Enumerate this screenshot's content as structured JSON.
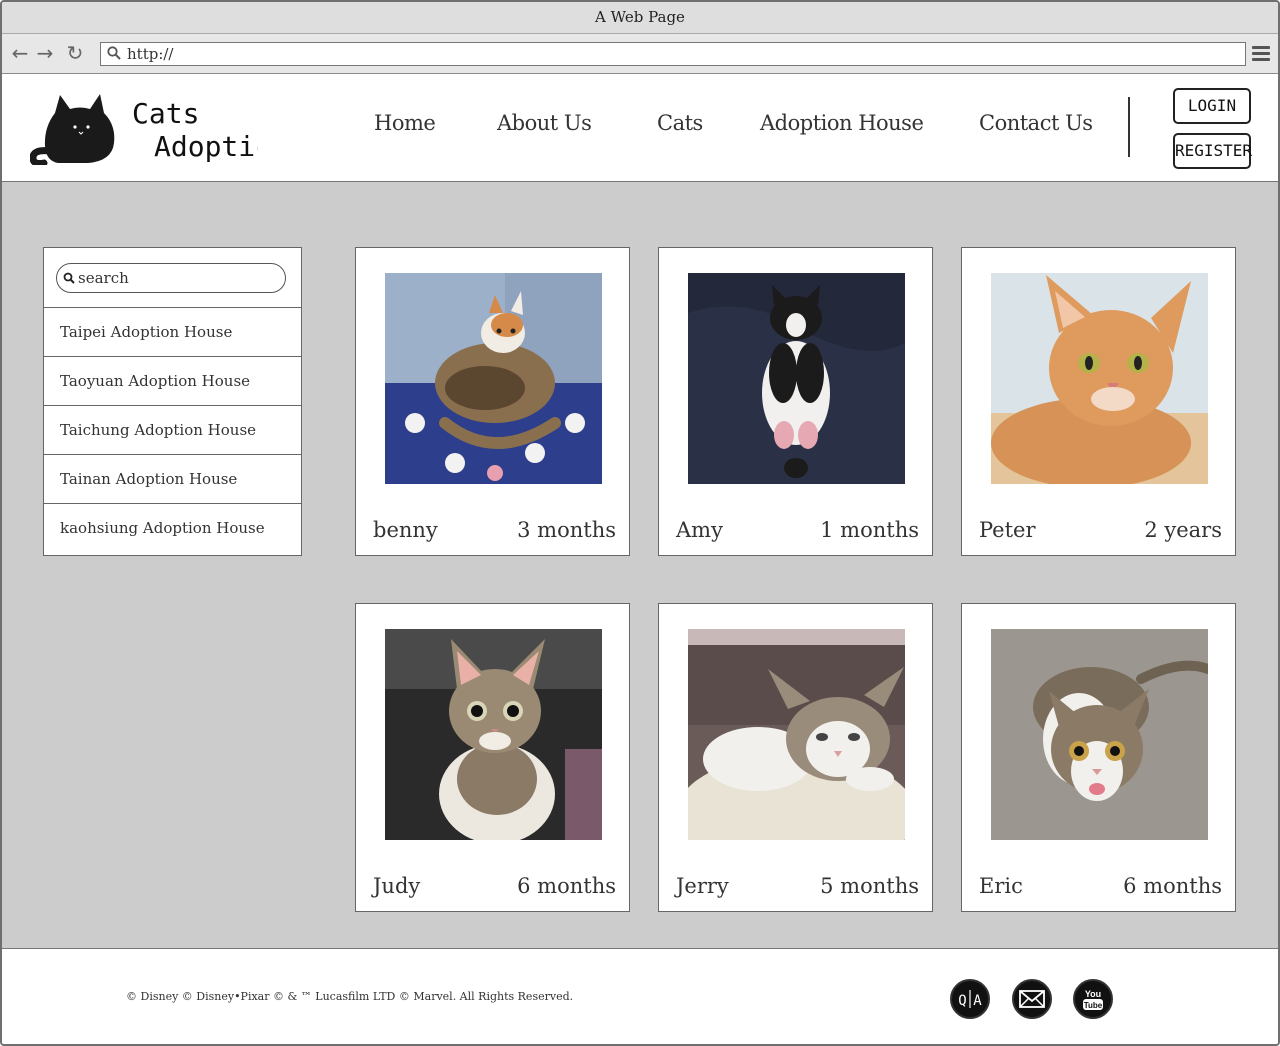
{
  "browser": {
    "window_title": "A Web Page",
    "url": "http://"
  },
  "header": {
    "logo_line1": "Cats",
    "logo_line2": "Adoptic",
    "nav": [
      {
        "label": "Home"
      },
      {
        "label": "About Us"
      },
      {
        "label": "Cats"
      },
      {
        "label": "Adoption House"
      },
      {
        "label": "Contact Us"
      }
    ],
    "login_label": "LOGIN",
    "register_label": "REGISTER"
  },
  "sidebar": {
    "search_placeholder": "search",
    "items": [
      {
        "label": "Taipei Adoption House"
      },
      {
        "label": "Taoyuan Adoption House"
      },
      {
        "label": "Taichung Adoption House"
      },
      {
        "label": "Tainan Adoption House"
      },
      {
        "label": "kaohsiung Adoption House"
      }
    ]
  },
  "cats": [
    {
      "name": "benny",
      "age": "3 months"
    },
    {
      "name": "Amy",
      "age": "1 months"
    },
    {
      "name": "Peter",
      "age": "2 years"
    },
    {
      "name": "Judy",
      "age": "6 months"
    },
    {
      "name": "Jerry",
      "age": "5 months"
    },
    {
      "name": "Eric",
      "age": "6 months"
    }
  ],
  "footer": {
    "copyright": "© Disney © Disney•Pixar © & ™ Lucasfilm LTD © Marvel. All Rights Reserved.",
    "social": [
      {
        "icon": "qa-icon"
      },
      {
        "icon": "mail-icon"
      },
      {
        "icon": "youtube-icon",
        "text_top": "You",
        "text_bottom": "Tube"
      }
    ]
  }
}
